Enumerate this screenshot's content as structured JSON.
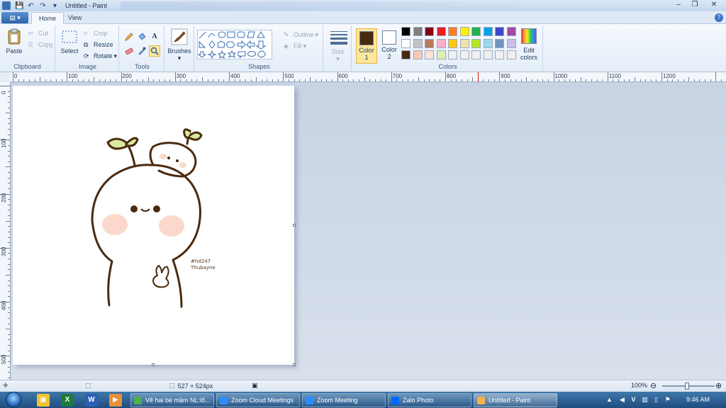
{
  "window": {
    "title": "Untitled - Paint",
    "controls": {
      "minimize": "–",
      "maximize": "❐",
      "close": "✕"
    }
  },
  "quick_access": {
    "save_icon": "💾",
    "undo_icon": "↶",
    "redo_icon": "↷",
    "menu_icon": "▾"
  },
  "app_menu": {
    "label": "▤ ▾"
  },
  "tabs": [
    {
      "label": "Home",
      "active": true
    },
    {
      "label": "View",
      "active": false
    }
  ],
  "help": {
    "label": "?"
  },
  "ribbon": {
    "clipboard": {
      "label": "Clipboard",
      "paste": "Paste",
      "cut": "Cut",
      "copy": "Copy"
    },
    "image": {
      "label": "Image",
      "select": "Select",
      "crop": "Crop",
      "resize": "Resize",
      "rotate": "Rotate"
    },
    "tools": {
      "label": "Tools",
      "text_tool": "A",
      "active_tool": "magnifier"
    },
    "brushes": {
      "label": "Brushes"
    },
    "shapes": {
      "label": "Shapes",
      "outline": "Outline",
      "fill": "Fill"
    },
    "size": {
      "label": "Size"
    },
    "colors": {
      "label": "Colors",
      "color1": {
        "label": "Color",
        "number": "1",
        "value": "#4a2a0e"
      },
      "color2": {
        "label": "Color",
        "number": "2",
        "value": "#ffffff"
      },
      "palette_row1": [
        "#000000",
        "#7f7f7f",
        "#880015",
        "#ed1c24",
        "#ff7f27",
        "#fff200",
        "#22b14c",
        "#00a2e8",
        "#3f48cc",
        "#a349a4"
      ],
      "palette_row2": [
        "#ffffff",
        "#c3c3c3",
        "#b97a57",
        "#ffaec9",
        "#ffc90e",
        "#efe4b0",
        "#b5e61d",
        "#99d9ea",
        "#7092be",
        "#c8bfe7"
      ],
      "palette_row3": [
        "#4a2a0e",
        "#f9c9b3",
        "#fde3d6",
        "#ddf0b5",
        "#f0f0f0",
        "#f0f0f0",
        "#f0f0f0",
        "#f0f0f0",
        "#f0f0f0",
        "#f0f0f0"
      ],
      "edit_colors_line1": "Edit",
      "edit_colors_line2": "colors"
    }
  },
  "ruler": {
    "h_labels": [
      "0",
      "100",
      "200",
      "300",
      "400",
      "500",
      "600",
      "700",
      "800",
      "900",
      "1000",
      "1100",
      "1200",
      "1300"
    ],
    "v_labels": [
      "0",
      "100",
      "200",
      "300",
      "400",
      "500"
    ]
  },
  "canvas": {
    "art_text_line1": "#hd247",
    "art_text_line2": "Thubayne",
    "accent_stroke": "#4a2a0e",
    "leaf_color": "#d9eba0",
    "blush_color": "#fcd8cc"
  },
  "status": {
    "dimensions": "527 × 524px",
    "zoom": "100%",
    "zoom_out": "⊖",
    "zoom_in": "⊕"
  },
  "taskbar": {
    "tasks": [
      {
        "label": "Vẽ hai bé mầm NL:lố...",
        "color": "#4caf50"
      },
      {
        "label": "Zoom Cloud Meetings",
        "color": "#2d8cff"
      },
      {
        "label": "Zoom Meeting",
        "color": "#2d8cff"
      },
      {
        "label": "Zalo Photo",
        "color": "#0068ff"
      },
      {
        "label": "Untitled - Paint",
        "color": "#f5b14c"
      }
    ],
    "pinned": [
      {
        "glyph": "▣",
        "color": "#f1c232"
      },
      {
        "glyph": "X",
        "color": "#1d7a3a"
      },
      {
        "glyph": "W",
        "color": "#2b5fb4"
      },
      {
        "glyph": "▶",
        "color": "#e69138"
      }
    ],
    "tray_lang": "V",
    "clock": "9:46 AM"
  }
}
